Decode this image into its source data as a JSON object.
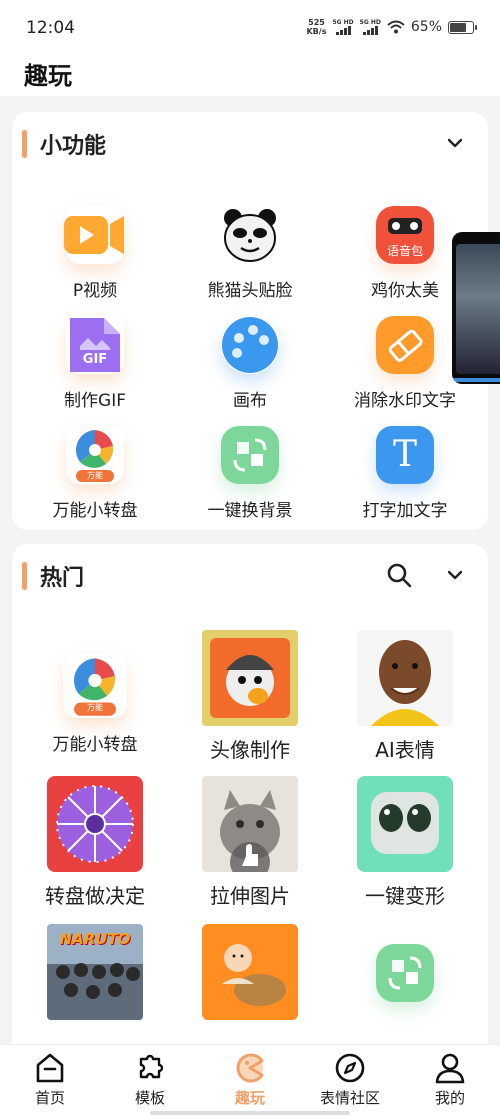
{
  "status": {
    "time": "12:04",
    "speed_value": "525",
    "speed_unit": "KB/s",
    "sig1": "5G HD",
    "sig2": "5G HD",
    "battery": "65%",
    "battery_level": 0.65
  },
  "app": {
    "title": "趣玩"
  },
  "features": {
    "title": "小功能",
    "items": [
      {
        "label": "P视频",
        "icon": "video-camera-icon"
      },
      {
        "label": "熊猫头贴脸",
        "icon": "panda-face-icon"
      },
      {
        "label": "鸡你太美",
        "icon": "voice-pack-icon",
        "badge": "语音包"
      },
      {
        "label": "制作GIF",
        "icon": "gif-file-icon",
        "badge": "GIF"
      },
      {
        "label": "画布",
        "icon": "palette-icon"
      },
      {
        "label": "消除水印文字",
        "icon": "eraser-icon"
      },
      {
        "label": "万能小转盘",
        "icon": "spin-wheel-icon",
        "badge": "万能"
      },
      {
        "label": "一键换背景",
        "icon": "swap-background-icon"
      },
      {
        "label": "打字加文字",
        "icon": "text-t-icon",
        "badge": "T"
      }
    ]
  },
  "hot": {
    "title": "热门",
    "items": [
      {
        "label": "万能小转盘",
        "icon": "spin-wheel-icon",
        "badge": "万能"
      },
      {
        "label": "头像制作",
        "icon": "avatar-maker-thumb"
      },
      {
        "label": "AI表情",
        "icon": "ai-face-thumb"
      },
      {
        "label": "转盘做决定",
        "icon": "decision-wheel-thumb"
      },
      {
        "label": "拉伸图片",
        "icon": "cat-stretch-thumb"
      },
      {
        "label": "一键变形",
        "icon": "morph-thumb"
      },
      {
        "label": "",
        "icon": "naruto-group-thumb",
        "badge": "NARUTO"
      },
      {
        "label": "",
        "icon": "monk-meme-thumb"
      },
      {
        "label": "",
        "icon": "swap-icon"
      }
    ]
  },
  "nav": {
    "items": [
      {
        "label": "首页",
        "icon": "home-icon"
      },
      {
        "label": "模板",
        "icon": "puzzle-icon"
      },
      {
        "label": "趣玩",
        "icon": "fun-icon"
      },
      {
        "label": "表情社区",
        "icon": "compass-icon"
      },
      {
        "label": "我的",
        "icon": "profile-icon"
      }
    ],
    "active_color": "#f0a06b"
  }
}
